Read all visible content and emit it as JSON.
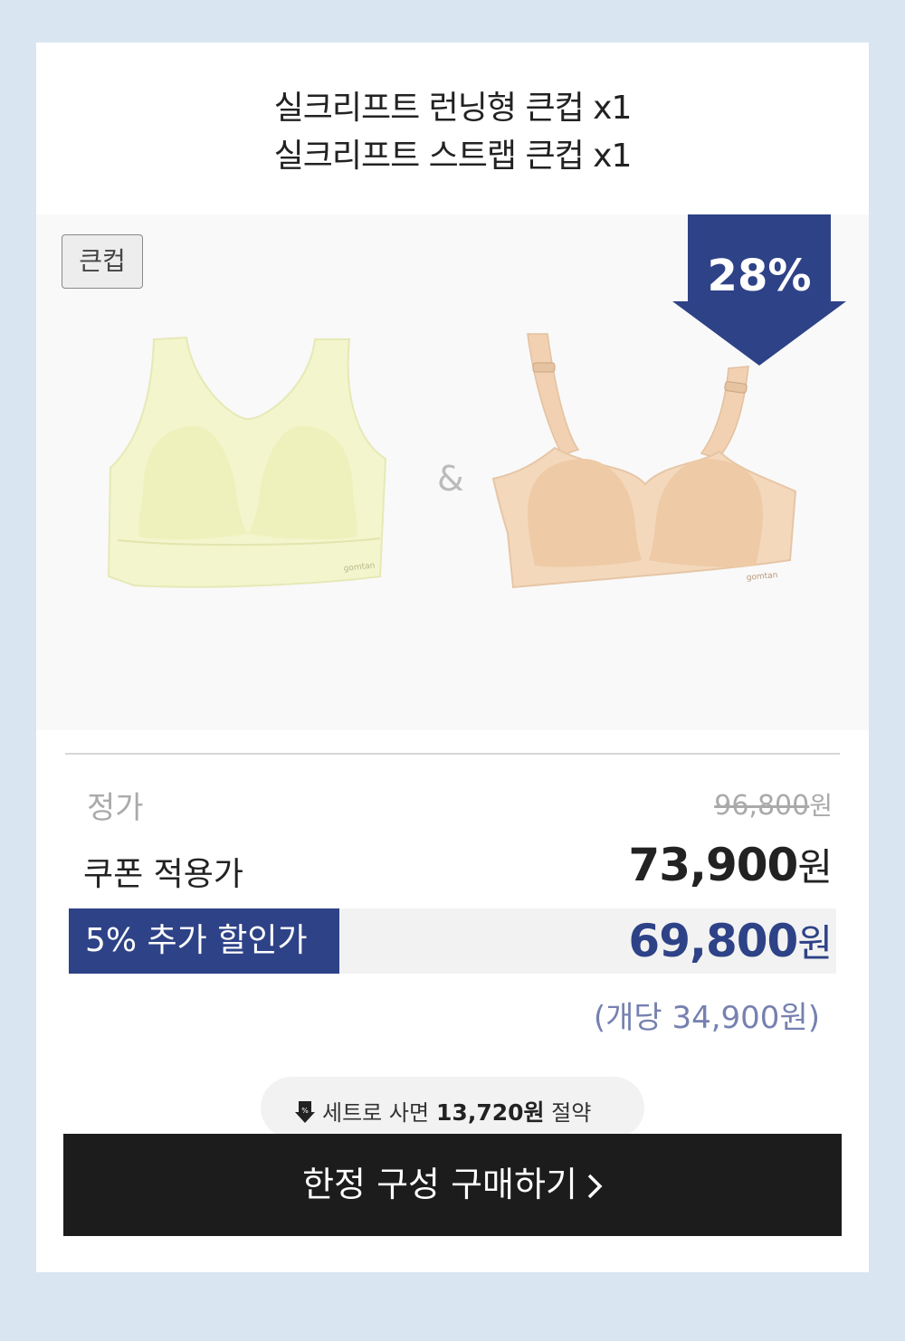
{
  "titles": [
    "실크리프트 런닝형 큰컵 x1",
    "실크리프트 스트랩 큰컵 x1"
  ],
  "hero": {
    "tag": "큰컵",
    "ampersand": "&",
    "discount": "28%",
    "products": [
      {
        "name": "runner-top",
        "color": "#f2f4c8",
        "brand": "gomtan"
      },
      {
        "name": "strap-bra",
        "color": "#f3d6b8",
        "brand": "gomtan"
      }
    ]
  },
  "prices": {
    "regular_label": "정가",
    "regular_value": "96,800",
    "coupon_label": "쿠폰 적용가",
    "coupon_value": "73,900",
    "extra_label": "5% 추가 할인가",
    "extra_value": "69,800",
    "unit": "원",
    "per_unit": "(개당 34,900원)"
  },
  "savings": {
    "icon": "discount-arrow-icon",
    "prefix": "세트로 사면",
    "amount": "13,720원",
    "suffix": "절약"
  },
  "cta": {
    "label": "한정 구성 구매하기",
    "icon": "chevron-right-icon"
  },
  "colors": {
    "accent": "#2e4287",
    "button": "#1c1c1c",
    "background": "#d9e6f1"
  }
}
